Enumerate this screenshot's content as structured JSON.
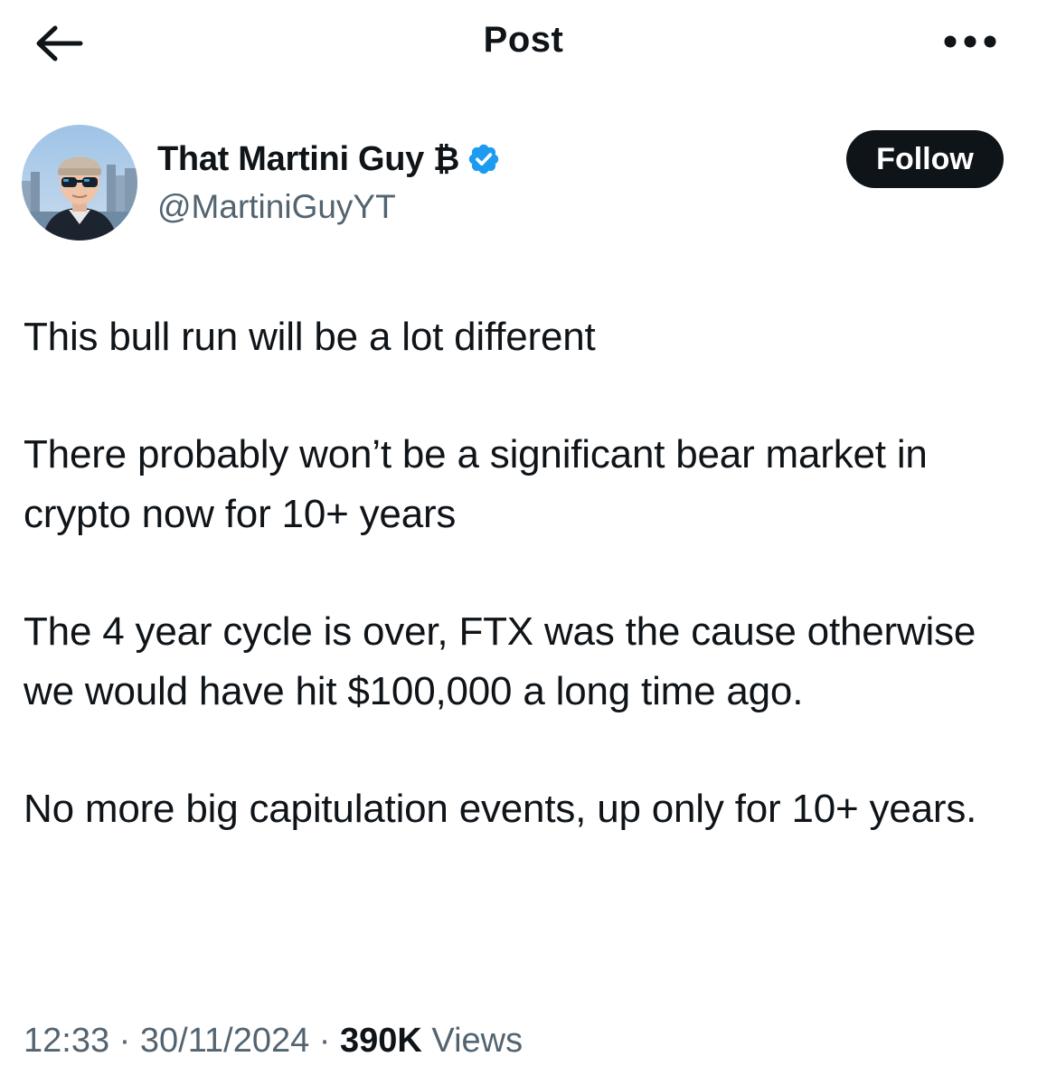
{
  "header": {
    "title": "Post",
    "back_icon": "arrow-left-icon",
    "more_icon": "more-horizontal-icon"
  },
  "author": {
    "name": "That Martini Guy",
    "name_emoji": "₿",
    "verified_icon": "verified-badge-icon",
    "verified_color": "#1d9bf0",
    "handle": "@MartiniGuyYT"
  },
  "follow_button": {
    "label": "Follow",
    "background": "#0f1419"
  },
  "post": {
    "paragraphs": [
      "This bull run will be a lot different",
      "There probably won’t be a significant bear market in crypto now for 10+ years",
      "The 4 year cycle is over, FTX was the cause otherwise we would have hit $100,000 a long time ago.",
      "No more big capitulation events, up only for 10+ years."
    ]
  },
  "meta": {
    "time": "12:33",
    "separator": " · ",
    "date": "30/11/2024",
    "views_count": "390K",
    "views_label": " Views"
  }
}
